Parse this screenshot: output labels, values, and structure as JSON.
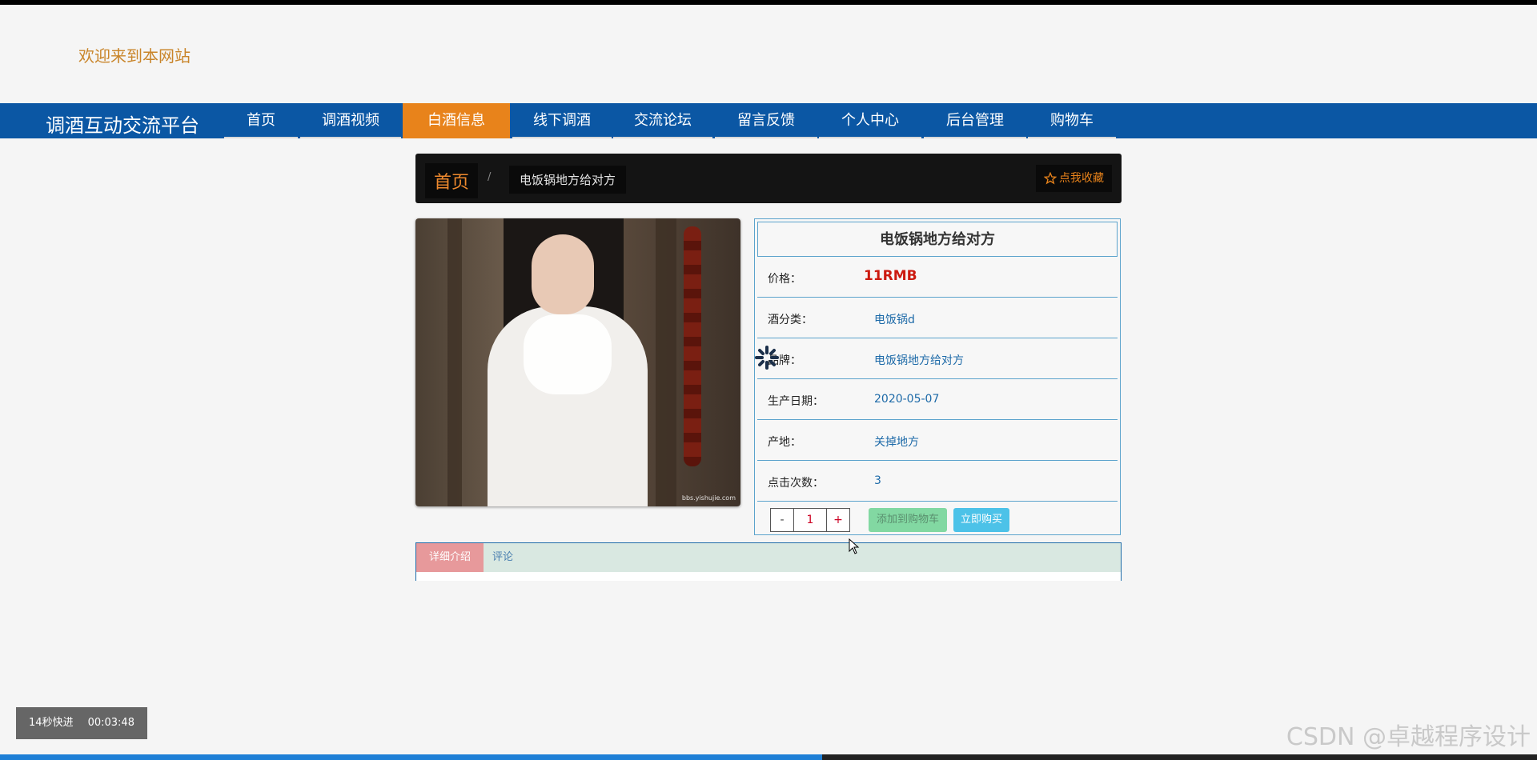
{
  "header": {
    "welcome": "欢迎来到本网站"
  },
  "nav": {
    "brand": "调酒互动交流平台",
    "items": [
      "首页",
      "调酒视频",
      "白酒信息",
      "线下调酒",
      "交流论坛",
      "留言反馈",
      "个人中心",
      "后台管理",
      "购物车"
    ],
    "active_index": 2
  },
  "breadcrumb": {
    "home": "首页",
    "separator": "/",
    "current": "电饭锅地方给对方",
    "favorite": "点我收藏"
  },
  "product": {
    "title": "电饭锅地方给对方",
    "image_watermark": "bbs.yishujie.com",
    "rows": [
      {
        "label": "价格：",
        "value": "11RMB"
      },
      {
        "label": "酒分类：",
        "value": "电饭锅d"
      },
      {
        "label": "品牌：",
        "value": "电饭锅地方给对方"
      },
      {
        "label": "生产日期：",
        "value": "2020-05-07"
      },
      {
        "label": "产地：",
        "value": "关掉地方"
      },
      {
        "label": "点击次数：",
        "value": "3"
      }
    ],
    "quantity": {
      "minus": "-",
      "value": "1",
      "plus": "+"
    },
    "add_to_cart": "添加到购物车",
    "buy_now": "立即购买"
  },
  "tabs": {
    "details": "详细介绍",
    "comments": "评论"
  },
  "player": {
    "skip": "14秒快进",
    "time": "00:03:48",
    "progress": 0.535
  },
  "watermark": "CSDN @卓越程序设计",
  "colors": {
    "nav": "#0b57a4",
    "accent": "#e8831b",
    "price": "#cc1a10",
    "border": "#5ba3cc"
  }
}
